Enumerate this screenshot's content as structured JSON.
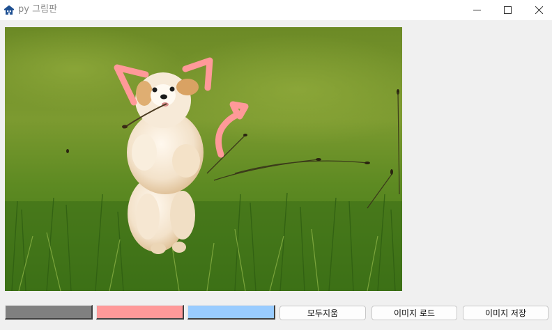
{
  "window": {
    "title": "py 그림판",
    "icon": "house-app-icon"
  },
  "colors": {
    "gray": "#808080",
    "pink": "#ff9999",
    "blue": "#99ccff",
    "stroke": "#ff9999"
  },
  "buttons": {
    "clear": "모두지움",
    "load": "이미지 로드",
    "save": "이미지 저장"
  }
}
